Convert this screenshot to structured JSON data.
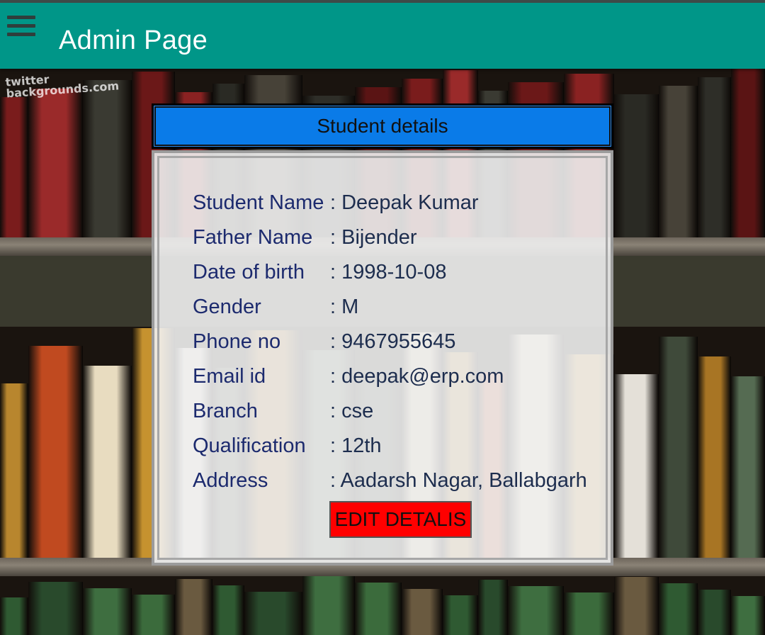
{
  "app_bar": {
    "title": "Admin Page",
    "color": "#009688",
    "menu_icon": "hamburger-menu-icon"
  },
  "background": {
    "watermark_line1": "twitter",
    "watermark_line2": "backgrounds.com"
  },
  "panel": {
    "title": "Student details",
    "title_bg": "#0a7be8",
    "fields": [
      {
        "label": "Student Name",
        "value": ": Deepak Kumar"
      },
      {
        "label": "Father Name",
        "value": ": Bijender"
      },
      {
        "label": "Date of birth",
        "value": ": 1998-10-08"
      },
      {
        "label": "Gender",
        "value": ": M"
      },
      {
        "label": "Phone no",
        "value": ": 9467955645"
      },
      {
        "label": "Email id",
        "value": ": deepak@erp.com"
      },
      {
        "label": "Branch",
        "value": ": cse"
      },
      {
        "label": "Qualification",
        "value": ": 12th"
      },
      {
        "label": "Address",
        "value": ": Aadarsh Nagar, Ballabgarh"
      }
    ],
    "edit_button_label": "EDIT DETALIS",
    "edit_button_color": "#ff0000"
  }
}
